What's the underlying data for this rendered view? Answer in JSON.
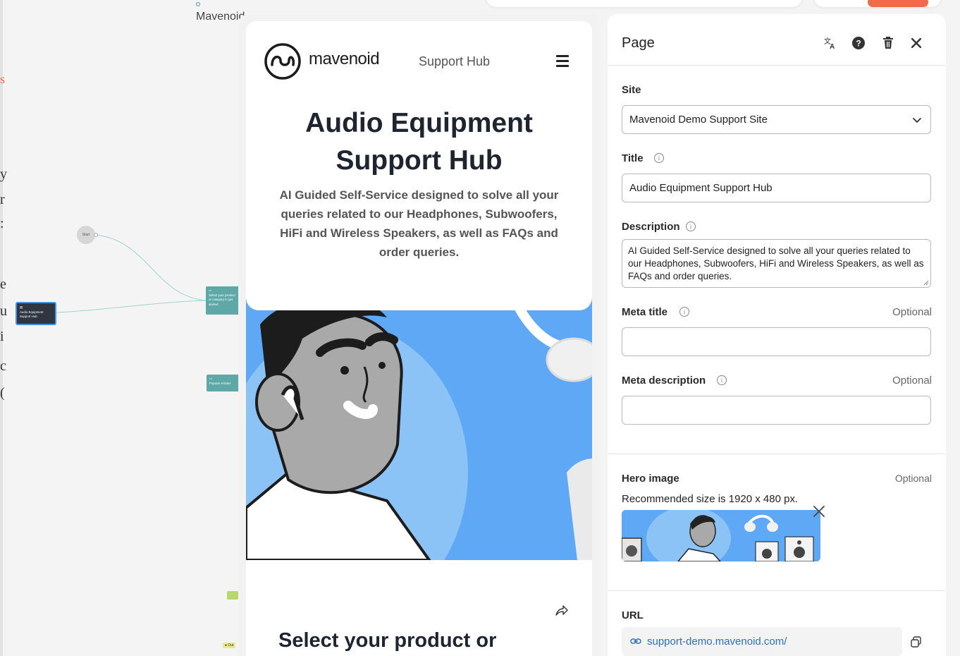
{
  "canvas": {
    "title": "Mavenoid Support Hub",
    "nodes": {
      "start_label": "Start",
      "hub_line1": "Audio Equipment",
      "hub_line2": "Support Hub",
      "select_text": "Select your product or category to get started",
      "popular_text": "Popular Articles",
      "tag_out": "Out"
    }
  },
  "preview": {
    "logo_text": "mavenoid",
    "nav_link": "Support Hub",
    "hero_title": "Audio Equipment Support Hub",
    "hero_description": "AI Guided Self-Service designed to solve all your queries related to our Headphones, Subwoofers, HiFi and Wireless Speakers, as well as FAQs and order queries.",
    "section_title": "Select your product or"
  },
  "panel": {
    "title": "Page",
    "icons": [
      "translate-icon",
      "help-icon",
      "trash-icon",
      "close-icon"
    ],
    "site": {
      "label": "Site",
      "value": "Mavenoid Demo Support Site"
    },
    "title_field": {
      "label": "Title",
      "value": "Audio Equipment Support Hub"
    },
    "description": {
      "label": "Description",
      "value": "AI Guided Self-Service designed to solve all your queries related to our Headphones, Subwoofers, HiFi and Wireless Speakers, as well as FAQs and order queries."
    },
    "meta_title": {
      "label": "Meta title",
      "optional": "Optional",
      "value": ""
    },
    "meta_description": {
      "label": "Meta description",
      "optional": "Optional",
      "value": ""
    },
    "hero_image": {
      "label": "Hero image",
      "optional": "Optional",
      "hint": "Recommended size is 1920 x 480 px."
    },
    "url": {
      "label": "URL",
      "value": "support-demo.mavenoid.com/"
    }
  },
  "colors": {
    "accent_blue": "#4a90e2",
    "hero_blue": "#5ea8f5",
    "link_blue": "#2d6fd0",
    "orange": "#f16a4a",
    "node_teal": "#5ea8a7",
    "node_dark": "#2f3642"
  }
}
